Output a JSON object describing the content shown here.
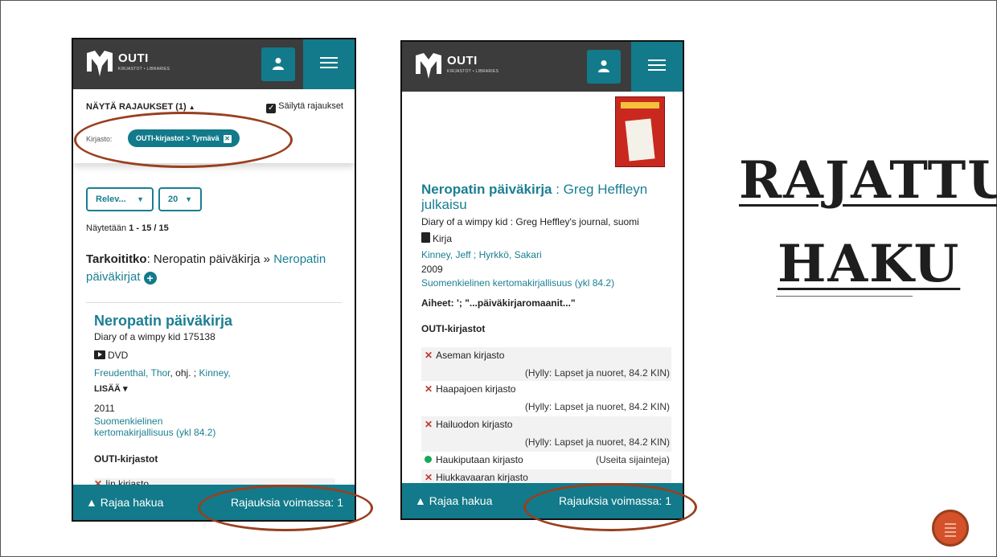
{
  "brand": {
    "name": "OUTI",
    "tagline": "KIRJASTOT • LIBRARIES"
  },
  "phone1": {
    "filters": {
      "toggle_label": "NÄYTÄ RAJAUKSET (1)",
      "toggle_caret": "▲",
      "keep_label": "Säilytä rajaukset",
      "keep_checked": true,
      "library_label": "Kirjasto:",
      "chip_label": "OUTI-kirjastot > Tyrnävä"
    },
    "sort_select": "Relev...",
    "limit_select": "20",
    "showing_prefix": "Näytetään",
    "showing_range": "1 - 15 / 15",
    "suggestion": {
      "label": "Tarkoititko",
      "original": "Neropatin päiväkirja",
      "arrow": "»",
      "suggested_a": "Neropatin",
      "suggested_b": "päiväkirjat"
    },
    "result": {
      "title": "Neropatin päiväkirja",
      "subtitle": "Diary of a wimpy kid 175138",
      "format": "DVD",
      "author1": "Freudenthal, Thor",
      "author1_role": ", ohj. ; ",
      "author2": "Kinney,",
      "more": "LISÄÄ ▾",
      "year": "2011",
      "class_line1": "Suomenkielinen",
      "class_line2": "kertomakirjallisuus (ykl 84.2)",
      "libraries_heading": "OUTI-kirjastot",
      "first_library": "Iin kirjasto"
    },
    "bottom": {
      "left": "▲ Rajaa hakua",
      "right": "Rajauksia voimassa: 1"
    }
  },
  "phone2": {
    "result": {
      "title_main": "Neropatin päiväkirja",
      "title_rest": " : Greg Heffleyn julkaisu",
      "subtitle": "Diary of a wimpy kid : Greg Heffley's journal, suomi",
      "format": "Kirja",
      "authors_a": "Kinney, Jeff",
      "authors_sep": " ; ",
      "authors_b": "Hyrkkö, Sakari",
      "year": "2009",
      "classification": "Suomenkielinen kertomakirjallisuus (ykl 84.2)",
      "subjects_label": "Aiheet:",
      "subjects_value": " '; \"...päiväkirjaromaanit...\"",
      "libraries_heading": "OUTI-kirjastot"
    },
    "holdings": [
      {
        "name": "Aseman kirjasto",
        "status": "unavailable",
        "shelf": "(Hylly: Lapset ja nuoret, 84.2 KIN)"
      },
      {
        "name": "Haapajoen kirjasto",
        "status": "unavailable",
        "shelf": "(Hylly: Lapset ja nuoret, 84.2 KIN)"
      },
      {
        "name": "Hailuodon kirjasto",
        "status": "unavailable",
        "shelf": "(Hylly: Lapset ja nuoret, 84.2 KIN)"
      },
      {
        "name": "Haukiputaan kirjasto",
        "status": "available",
        "shelf": "(Useita sijainteja)"
      },
      {
        "name": "Hiukkavaaran kirjasto",
        "status": "unavailable",
        "shelf": ""
      }
    ],
    "bottom": {
      "left": "▲ Rajaa hakua",
      "right": "Rajauksia voimassa: 1"
    }
  },
  "slide_title": {
    "line1": "RAJATTU",
    "line2": "HAKU"
  },
  "colors": {
    "teal": "#127a8a",
    "link": "#1a7f92",
    "topbar": "#3c3c3c",
    "annotation": "#9a3f1e",
    "accent_orb": "#d4512a"
  }
}
